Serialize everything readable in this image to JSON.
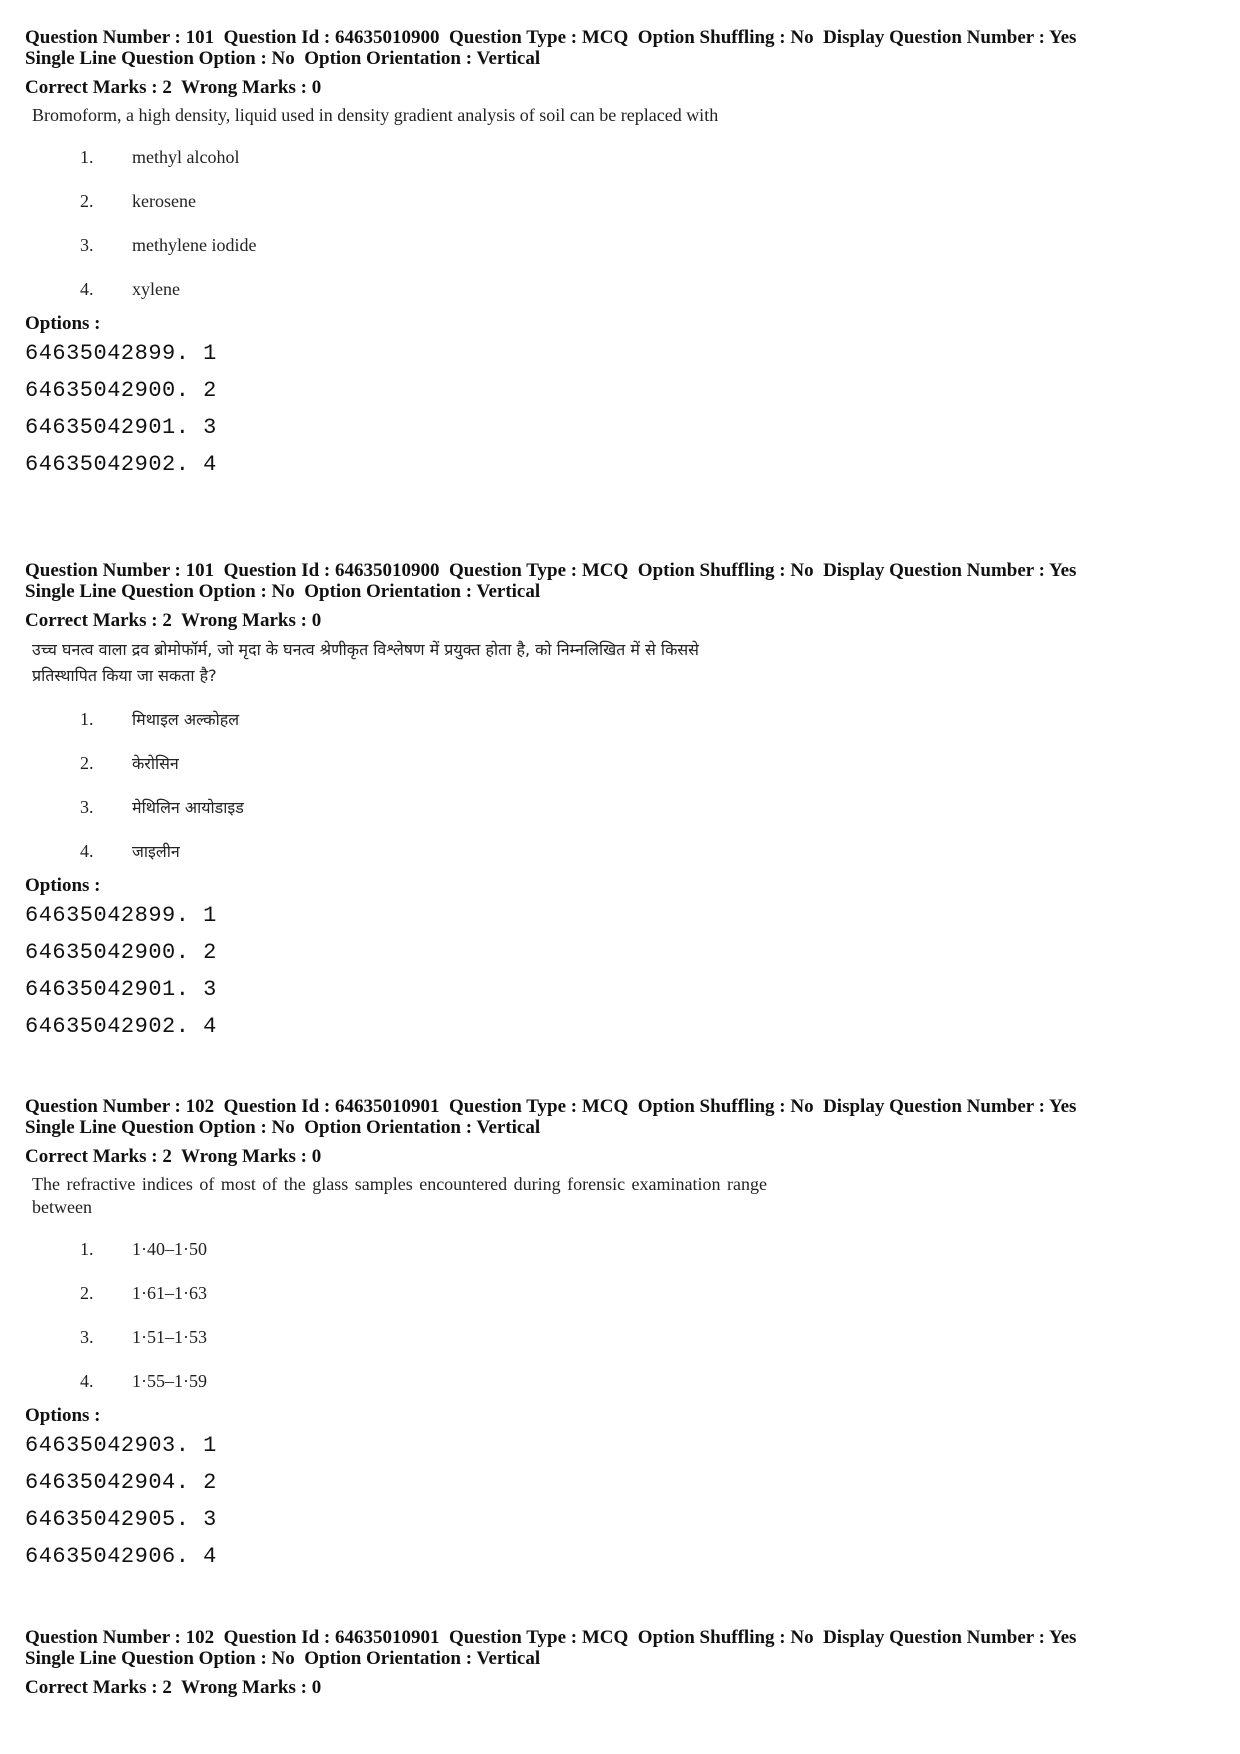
{
  "questions": [
    {
      "meta_line1": "Question Number : 101  Question Id : 64635010900  Question Type : MCQ  Option Shuffling : No  Display Question Number : Yes",
      "meta_line2": "Single Line Question Option : No  Option Orientation : Vertical",
      "marks": "Correct Marks : 2  Wrong Marks : 0",
      "text": "Bromoform, a high density, liquid used in density gradient analysis of soil can be replaced with",
      "choices": [
        {
          "num": "1.",
          "label": "methyl alcohol"
        },
        {
          "num": "2.",
          "label": "kerosene"
        },
        {
          "num": "3.",
          "label": "methylene iodide"
        },
        {
          "num": "4.",
          "label": "xylene"
        }
      ],
      "options_label": "Options :",
      "option_ids": [
        "64635042899. 1",
        "64635042900. 2",
        "64635042901. 3",
        "64635042902. 4"
      ]
    },
    {
      "meta_line1": "Question Number : 101  Question Id : 64635010900  Question Type : MCQ  Option Shuffling : No  Display Question Number : Yes",
      "meta_line2": "Single Line Question Option : No  Option Orientation : Vertical",
      "marks": "Correct Marks : 2  Wrong Marks : 0",
      "text": "उच्च घनत्व वाला द्रव ब्रोमोफॉर्म, जो मृदा के घनत्व श्रेणीकृत विश्लेषण में प्रयुक्त होता है, को निम्नलिखित में से किससे प्रतिस्थापित किया जा सकता है?",
      "choices": [
        {
          "num": "1.",
          "label": "मिथाइल अल्कोहल"
        },
        {
          "num": "2.",
          "label": "केरोसिन"
        },
        {
          "num": "3.",
          "label": "मेथिलिन आयोडाइड"
        },
        {
          "num": "4.",
          "label": "जाइलीन"
        }
      ],
      "options_label": "Options :",
      "option_ids": [
        "64635042899. 1",
        "64635042900. 2",
        "64635042901. 3",
        "64635042902. 4"
      ]
    },
    {
      "meta_line1": "Question Number : 102  Question Id : 64635010901  Question Type : MCQ  Option Shuffling : No  Display Question Number : Yes",
      "meta_line2": "Single Line Question Option : No  Option Orientation : Vertical",
      "marks": "Correct Marks : 2  Wrong Marks : 0",
      "text": "The refractive indices of most of the glass samples encountered during forensic examination range between",
      "choices": [
        {
          "num": "1.",
          "label": "1·40–1·50"
        },
        {
          "num": "2.",
          "label": "1·61–1·63"
        },
        {
          "num": "3.",
          "label": "1·51–1·53"
        },
        {
          "num": "4.",
          "label": "1·55–1·59"
        }
      ],
      "options_label": "Options :",
      "option_ids": [
        "64635042903. 1",
        "64635042904. 2",
        "64635042905. 3",
        "64635042906. 4"
      ]
    },
    {
      "meta_line1": "Question Number : 102  Question Id : 64635010901  Question Type : MCQ  Option Shuffling : No  Display Question Number : Yes",
      "meta_line2": "Single Line Question Option : No  Option Orientation : Vertical",
      "marks": "Correct Marks : 2  Wrong Marks : 0"
    }
  ]
}
